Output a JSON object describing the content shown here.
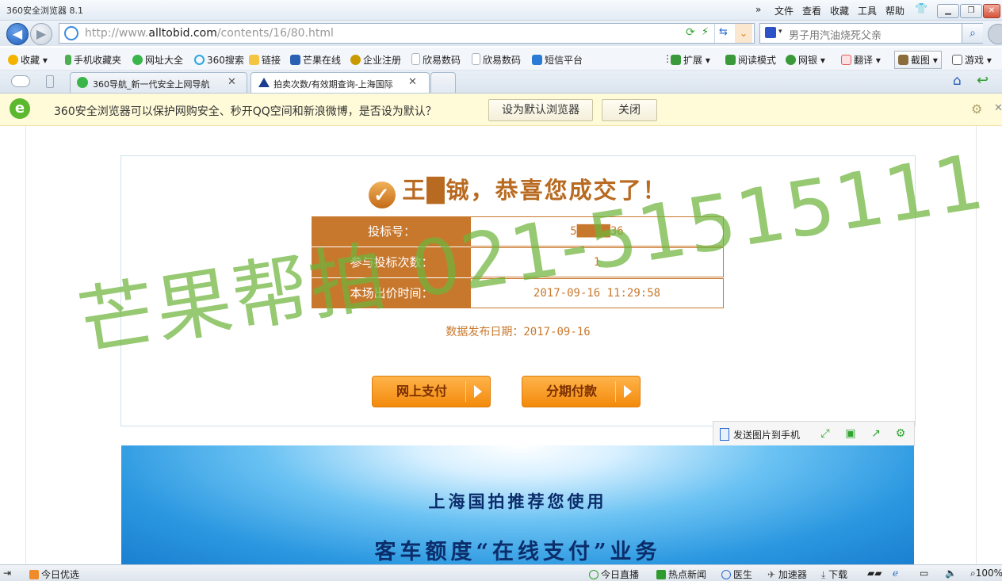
{
  "titlebar": {
    "title": "360安全浏览器 8.1",
    "menu_symbol": "»",
    "menu": [
      "文件",
      "查看",
      "收藏",
      "工具",
      "帮助"
    ],
    "skin_icon": "shirt-icon"
  },
  "address": {
    "url_prefix": "http://www.",
    "url_domain": "alltobid.com",
    "url_path": "/contents/16/80.html",
    "search_query": "男子用汽油烧死父亲"
  },
  "bookmarks": [
    {
      "label": "收藏",
      "icon": "star-icon",
      "color": "#f2b400"
    },
    {
      "label": "手机收藏夹",
      "icon": "phone-icon",
      "color": "#4caf50"
    },
    {
      "label": "网址大全",
      "icon": "plus-globe-icon",
      "color": "#39b54a"
    },
    {
      "label": "360搜索",
      "icon": "search-360-icon",
      "color": "#2ea7e0"
    },
    {
      "label": "链接",
      "icon": "folder-icon",
      "color": "#f5c542"
    },
    {
      "label": "芒果在线",
      "icon": "flag-icon",
      "color": "#2b5fb4"
    },
    {
      "label": "企业注册",
      "icon": "bag-icon",
      "color": "#c99a00"
    },
    {
      "label": "欣易数码",
      "icon": "page-icon",
      "color": "#cfd6df"
    },
    {
      "label": "欣易数码",
      "icon": "page-icon",
      "color": "#cfd6df"
    },
    {
      "label": "短信平台",
      "icon": "sms-icon",
      "color": "#2b7bd6"
    }
  ],
  "toolbar_right": [
    {
      "label": "扩展",
      "icon": "extension-icon",
      "color": "#3a9a3a"
    },
    {
      "label": "阅读模式",
      "icon": "book-icon",
      "color": "#3a9a3a"
    },
    {
      "label": "网银",
      "icon": "bank-icon",
      "color": "#3a9a3a"
    },
    {
      "label": "翻译",
      "icon": "translate-icon",
      "color": "#e35d5d"
    },
    {
      "label": "截图",
      "icon": "scissors-icon",
      "color": "#8a6d3b"
    },
    {
      "label": "游戏",
      "icon": "gamepad-icon",
      "color": "#666666"
    }
  ],
  "tabs": [
    {
      "label": "360导航_新一代安全上网导航",
      "icon": "nav360-icon"
    },
    {
      "label": "拍卖次数/有效期查询-上海国际",
      "icon": "auction-icon"
    }
  ],
  "notice": {
    "message": "360安全浏览器可以保护网购安全、秒开QQ空间和新浪微博，是否设为默认？",
    "set_default": "设为默认浏览器",
    "close": "关闭"
  },
  "result": {
    "headline": "王█铖，恭喜您成交了！",
    "rows": [
      {
        "label": "投标号：",
        "value": "5█████36"
      },
      {
        "label": "参与投标次数：",
        "value": "1"
      },
      {
        "label": "本场出价时间：",
        "value": "2017-09-16 11:29:58"
      }
    ],
    "publish_date": "数据发布日期：2017-09-16",
    "pay_online": "网上支付",
    "pay_installment": "分期付款"
  },
  "image_tools": {
    "send_to_phone": "发送图片到手机"
  },
  "banner": {
    "line1": "上海国拍推荐您使用",
    "line2": "客车额度“在线支付”业务"
  },
  "watermark": "芒果帮拍 021-51515111",
  "statusbar": {
    "today": "今日优选",
    "live": "今日直播",
    "hot_news": "热点新闻",
    "doctor": "医生",
    "accelerator": "加速器",
    "download": "下载",
    "zoom": "100%"
  },
  "colors": {
    "accent_orange": "#c8782d",
    "watermark_green": "#6eb43c",
    "pay_button": "#f28a0c",
    "banner_blue": "#2a97e0"
  }
}
